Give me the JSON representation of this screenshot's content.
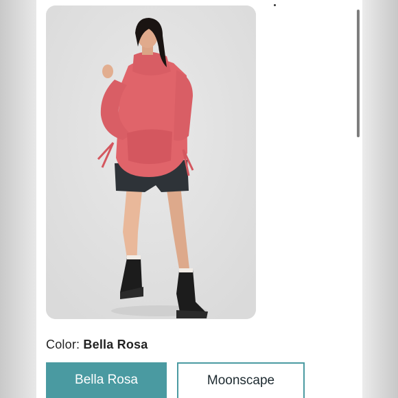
{
  "product": {
    "image_alt": "Model wearing pink turtleneck pullover with black shorts and boots",
    "color_label": "Color:",
    "color_value": "Bella Rosa",
    "swatches": [
      {
        "label": "Bella Rosa",
        "selected": true
      },
      {
        "label": "Moonscape",
        "selected": false
      }
    ]
  },
  "colors": {
    "accent": "#4a9aa1",
    "sweater": "#e0646a",
    "background": "#e3e3e3"
  }
}
